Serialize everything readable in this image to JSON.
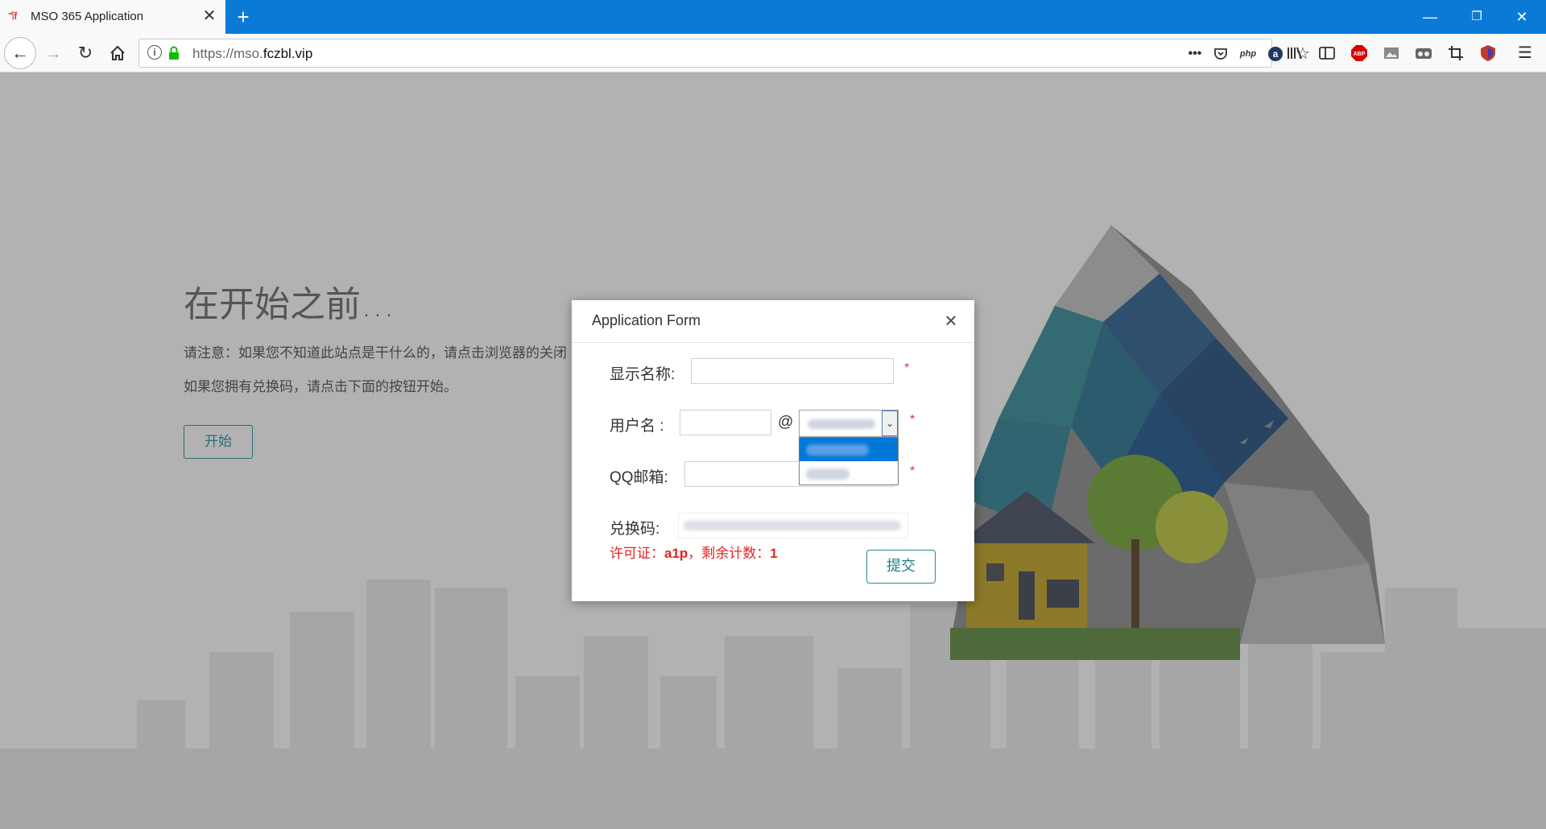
{
  "browser": {
    "tab_title": "MSO 365 Application",
    "tab_favicon": "ℸ͠f",
    "url_scheme": "https://mso.",
    "url_domain": "fczbl.vip",
    "url_ext_php": "php"
  },
  "page": {
    "headline": "在开始之前...",
    "notice_line1": "请注意：如果您不知道此站点是干什么的，请点击浏览器的关闭",
    "notice_line2": "如果您拥有兑换码，请点击下面的按钮开始。",
    "start_label": "开始"
  },
  "modal": {
    "title": "Application Form",
    "display_name_label": "显示名称:",
    "username_label": "用户名 :",
    "at_sign": "@",
    "qq_email_label": "QQ邮箱:",
    "redeem_code_label": "兑换码:",
    "required_mark": "*",
    "license_prefix": "许可证：",
    "license_value": "a1p",
    "license_mid": "，剩余计数：",
    "license_count": "1",
    "submit_label": "提交",
    "display_name_value": "",
    "username_value": "",
    "qq_email_value": ""
  },
  "colors": {
    "tabstrip": "#0a7ad6",
    "accent_button": "#2a8a93",
    "required": "#e03030",
    "license_text": "#e52121",
    "dropdown_selected": "#0078d7"
  }
}
